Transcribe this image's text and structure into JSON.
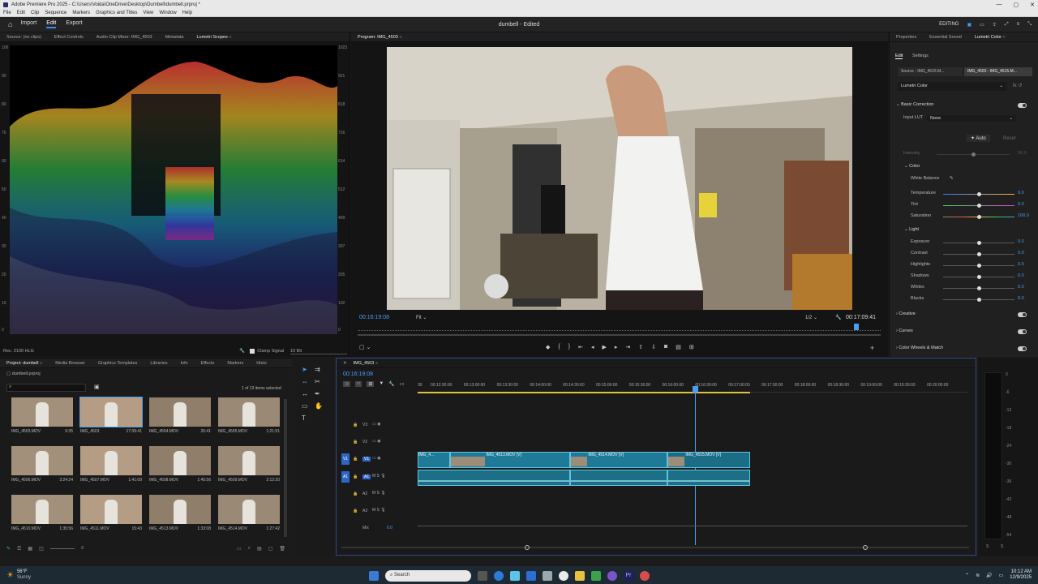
{
  "titlebar": {
    "title": "Adobe Premiere Pro 2025 - C:\\Users\\Voida\\OneDrive\\Desktop\\Dumbell\\dumbell.prproj *"
  },
  "menu": [
    "File",
    "Edit",
    "Clip",
    "Sequence",
    "Markers",
    "Graphics and Titles",
    "View",
    "Window",
    "Help"
  ],
  "header": {
    "tabs": [
      "Import",
      "Edit",
      "Export"
    ],
    "active": "Edit",
    "project_title": "dumbell - Edited",
    "editing_label": "EDITING"
  },
  "source_tabs": [
    "Source: (no clips)",
    "Effect Controls",
    "Audio Clip Mixer: IMG_4503",
    "Metadata",
    "Lumetri Scopes"
  ],
  "scope": {
    "left_axis": [
      "100",
      "90",
      "80",
      "70",
      "60",
      "50",
      "40",
      "30",
      "20",
      "10",
      "0"
    ],
    "right_axis": [
      "1023",
      "921",
      "818",
      "716",
      "614",
      "512",
      "409",
      "307",
      "205",
      "102",
      "0"
    ],
    "rec_label": "Rec. 2100 HLG",
    "clamp_label": "Clamp Signal",
    "bits": "10 Bit"
  },
  "program": {
    "tab": "Program: IMG_4503",
    "timecode": "00:16:19:08",
    "fit": "Fit",
    "resolution": "1/2",
    "duration": "00:17:09:41"
  },
  "right": {
    "tabs": [
      "Properties",
      "Essential Sound",
      "Lumetri Color"
    ],
    "subtabs": [
      "Edit",
      "Settings"
    ],
    "source_chip": "Source - IMG_4515.M...",
    "seq_chip": "IMG_4503 - IMG_4515.M...",
    "effect_select": "Lumetri Color",
    "basic_correction": "Basic Correction",
    "input_lut_label": "Input LUT",
    "input_lut_value": "None",
    "auto": "Auto",
    "reset": "Reset",
    "intensity": "Intensity",
    "intensity_val": "50.0",
    "color_section": "Color",
    "white_balance": "White Balance",
    "color_rows": [
      {
        "label": "Temperature",
        "value": "0.0",
        "level": 0.5
      },
      {
        "label": "Tint",
        "value": "0.0",
        "level": 0.5
      },
      {
        "label": "Saturation",
        "value": "100.0",
        "level": 0.5
      }
    ],
    "light_section": "Light",
    "light_rows": [
      {
        "label": "Exposure",
        "value": "0.0",
        "level": 0.5
      },
      {
        "label": "Contrast",
        "value": "0.0",
        "level": 0.5
      },
      {
        "label": "Highlights",
        "value": "0.0",
        "level": 0.5
      },
      {
        "label": "Shadows",
        "value": "0.0",
        "level": 0.5
      },
      {
        "label": "Whites",
        "value": "0.0",
        "level": 0.5
      },
      {
        "label": "Blacks",
        "value": "0.0",
        "level": 0.5
      }
    ],
    "sections": [
      "Creative",
      "Curves",
      "Color Wheels & Match"
    ]
  },
  "project": {
    "tabs": [
      "Project: dumbell",
      "Media Browser",
      "Graphics Templates",
      "Libraries",
      "Info",
      "Effects",
      "Markers",
      "Histo"
    ],
    "bin": "dumbell.prproj",
    "selected": "1 of 13 items selected",
    "clips": [
      {
        "name": "IMG_4503.MOV",
        "dur": "9:35"
      },
      {
        "name": "IMG_4503",
        "dur": "17:09:41"
      },
      {
        "name": "IMG_4504.MOV",
        "dur": "26:41"
      },
      {
        "name": "IMG_4505.MOV",
        "dur": "1:21:51"
      },
      {
        "name": "IMG_4506.MOV",
        "dur": "3:24:24"
      },
      {
        "name": "IMG_4507.MOV",
        "dur": "1:41:09"
      },
      {
        "name": "IMG_4508.MOV",
        "dur": "1:45:56"
      },
      {
        "name": "IMG_4509.MOV",
        "dur": "2:12:20"
      },
      {
        "name": "IMG_4510.MOV",
        "dur": "1:35:56"
      },
      {
        "name": "IMG_4511.MOV",
        "dur": "15:43"
      },
      {
        "name": "IMG_4513.MOV",
        "dur": "1:33:08"
      },
      {
        "name": "IMG_4514.MOV",
        "dur": "1:27:42"
      }
    ]
  },
  "timeline": {
    "tab": "IMG_4503",
    "timecode": "00:16:19:08",
    "ruler": [
      "00:12:30:00",
      "00:13:00:00",
      "00:13:30:00",
      "00:14:00:00",
      "00:14:30:00",
      "00:15:00:00",
      "00:15:30:00",
      "00:16:00:00",
      "00:16:30:00",
      "00:17:00:00",
      "00:17:30:00",
      "00:18:00:00",
      "00:18:30:00",
      "00:19:00:00",
      "00:19:30:00",
      "00:20:00:00"
    ],
    "ruler_start": "30",
    "tracks": [
      "V3",
      "V2",
      "V1",
      "A1",
      "A2",
      "A3"
    ],
    "mix": "Mix",
    "mix_val": "0.0",
    "clips": [
      {
        "label": "IMG_4...",
        "track": "V1"
      },
      {
        "label": "IMG_4513.MOV [V]",
        "track": "V1"
      },
      {
        "label": "IMG_4514.MOV [V]",
        "track": "V1"
      },
      {
        "label": "IMG_4515.MOV [V]",
        "track": "V1"
      }
    ]
  },
  "meters": {
    "scale": [
      "0",
      "-6",
      "-12",
      "-18",
      "-24",
      "-30",
      "-36",
      "-42",
      "-48",
      "-54"
    ],
    "bottom": [
      "S",
      "S"
    ]
  },
  "taskbar": {
    "temp": "56°F",
    "weather": "Sunny",
    "search": "Search",
    "time": "10:12 AM",
    "date": "12/9/2025"
  }
}
